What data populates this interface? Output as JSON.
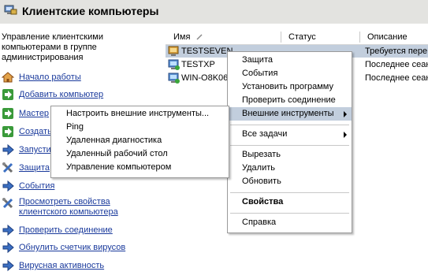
{
  "window": {
    "title": "Клиентские компьютеры"
  },
  "left_panel": {
    "description": "Управление клиентскими компьютерами в группе администрирования",
    "tasks": [
      {
        "label": "Начало работы",
        "icon": "home-icon"
      },
      {
        "label": "Добавить компьютер",
        "icon": "green-arrow-icon"
      },
      {
        "label": "Мастер",
        "icon": "green-arrow-icon"
      },
      {
        "label": "Создать",
        "icon": "green-arrow-icon"
      },
      {
        "label": "Запусти",
        "icon": "blue-arrow-icon"
      },
      {
        "label": "Защита",
        "icon": "tools-icon"
      },
      {
        "label": "События",
        "icon": "blue-arrow-icon"
      },
      {
        "label": "Просмотреть свойства клиентского компьютера",
        "icon": "tools-icon"
      },
      {
        "label": "Проверить соединение",
        "icon": "blue-arrow-icon"
      },
      {
        "label": "Обнулить счетчик вирусов",
        "icon": "blue-arrow-icon"
      },
      {
        "label": "Вирусная активность",
        "icon": "blue-arrow-icon"
      }
    ]
  },
  "table": {
    "columns": [
      "Имя",
      "Статус",
      "Описание стату"
    ],
    "rows": [
      {
        "name": "TESTSEVEN",
        "status": "",
        "desc": "Требуется пере",
        "icon": "computer-warning-icon",
        "selected": true
      },
      {
        "name": "TESTXP",
        "status": "",
        "desc": "Последнее сеанс",
        "icon": "computer-ok-icon",
        "selected": false
      },
      {
        "name": "WIN-O8K06I",
        "status": "",
        "desc": "Последнее сеанс",
        "icon": "computer-ok-icon",
        "selected": false
      }
    ]
  },
  "context_menu": {
    "items": [
      "Защита",
      "События",
      "Установить программу",
      "Проверить соединение",
      "Внешние инструменты",
      "Все задачи",
      "Вырезать",
      "Удалить",
      "Обновить",
      "Свойства",
      "Справка"
    ]
  },
  "submenu": {
    "items": [
      "Настроить внешние инструменты...",
      "Ping",
      "Удаленная диагностика",
      "Удаленный рабочий стол",
      "Управление компьютером"
    ]
  },
  "colors": {
    "link": "#1a3a9c",
    "highlight": "#c2cedd",
    "titlebar": "#e3e3e0"
  }
}
